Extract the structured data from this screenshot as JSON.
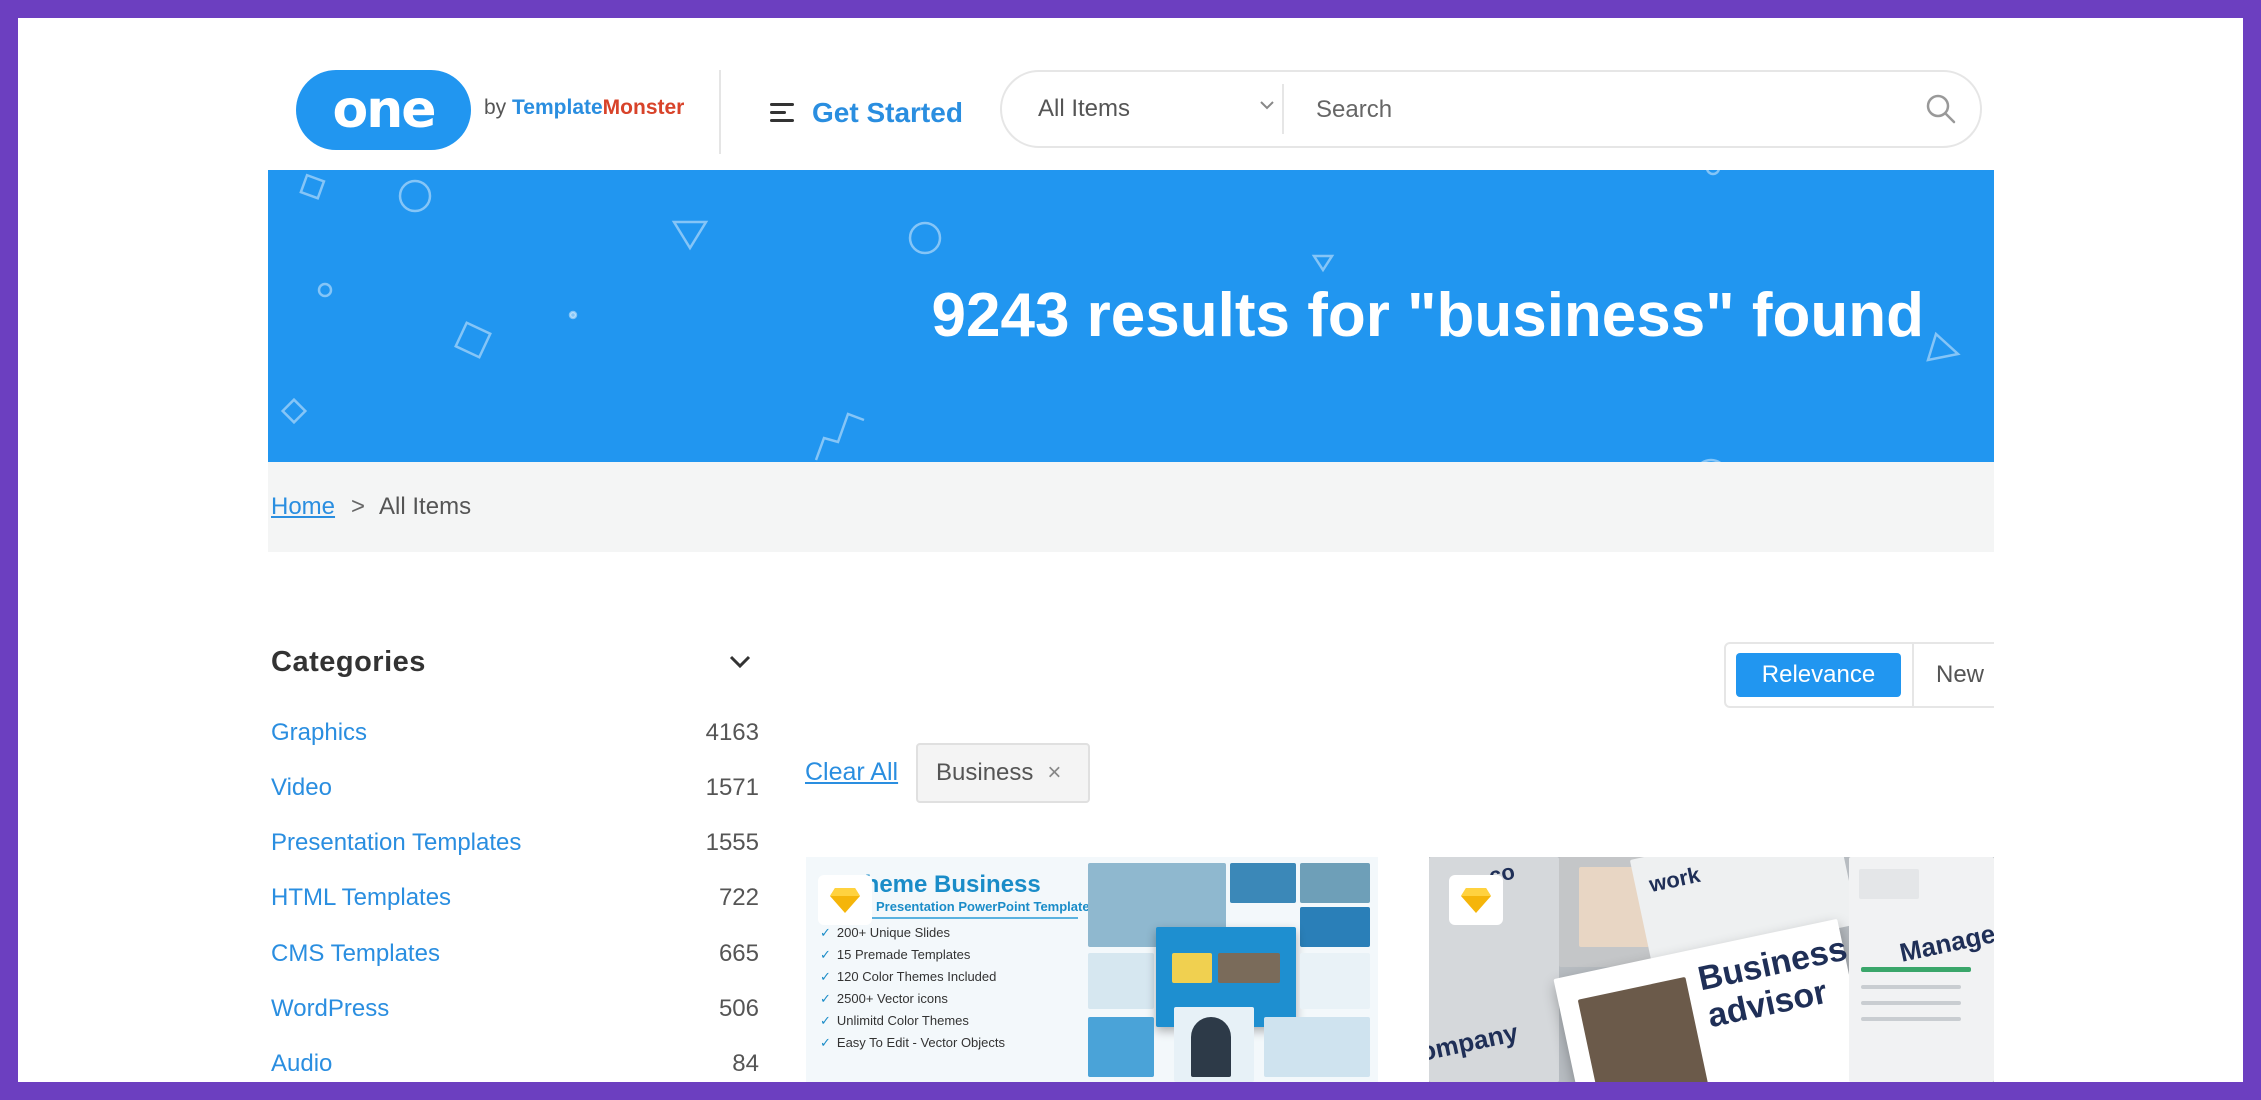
{
  "header": {
    "logo_text": "one",
    "logo_by": "by",
    "logo_brand_a": "Template",
    "logo_brand_b": "Monster",
    "get_started": "Get Started",
    "category_select": "All Items",
    "search_placeholder": "Search"
  },
  "hero": {
    "title": "9243 results for \"business\" found"
  },
  "breadcrumb": {
    "home": "Home",
    "separator": ">",
    "current": "All Items"
  },
  "sidebar": {
    "title": "Categories",
    "items": [
      {
        "label": "Graphics",
        "count": "4163"
      },
      {
        "label": "Video",
        "count": "1571"
      },
      {
        "label": "Presentation Templates",
        "count": "1555"
      },
      {
        "label": "HTML Templates",
        "count": "722"
      },
      {
        "label": "CMS Templates",
        "count": "665"
      },
      {
        "label": "WordPress",
        "count": "506"
      },
      {
        "label": "Audio",
        "count": "84"
      }
    ]
  },
  "sort": {
    "active": "Relevance",
    "next": "New"
  },
  "filters": {
    "clear_all": "Clear All",
    "active_tag": "Business",
    "remove_symbol": "×"
  },
  "cards": [
    {
      "title": "Theme Business",
      "subtitle": "Presentation PowerPoint Template",
      "features": [
        "200+ Unique Slides",
        "15 Premade Templates",
        "120 Color Themes Included",
        "2500+ Vector icons",
        "Unlimitd Color Themes",
        "Easy To Edit - Vector Objects"
      ]
    },
    {
      "headline_1": "Business",
      "headline_2": "advisor",
      "side_text": "Manager",
      "left_text": "ompany",
      "top_text": "work",
      "corner_text": "co"
    }
  ],
  "colors": {
    "frame": "#6c3fc0",
    "primary": "#2196f0",
    "link": "#2a8ee0",
    "brand_red": "#d8432a"
  },
  "icons": [
    "menu-icon",
    "chevron-down-icon",
    "search-icon",
    "close-icon",
    "diamond-icon"
  ]
}
